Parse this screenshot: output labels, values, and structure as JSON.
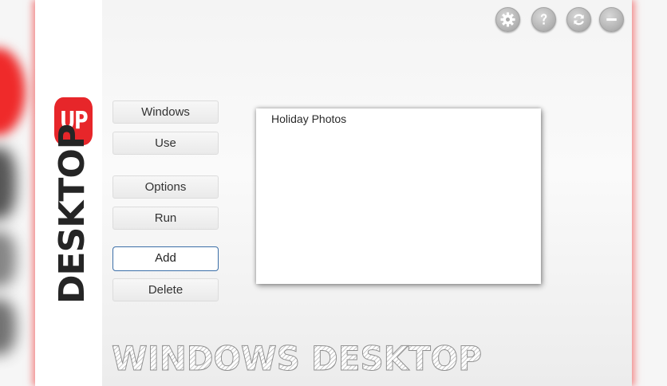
{
  "logo": {
    "up_text": "UP",
    "desktop_text": "DESKTOP",
    "accent_color": "#e7262a"
  },
  "toolbar": {
    "icons": [
      "gear-icon",
      "help-icon",
      "refresh-icon",
      "minimize-icon"
    ]
  },
  "side_buttons": {
    "windows": "Windows",
    "use": "Use",
    "options": "Options",
    "run": "Run",
    "add": "Add",
    "delete": "Delete"
  },
  "list": {
    "items": [
      "Holiday Photos"
    ]
  },
  "footer": {
    "label": "WINDOWS DESKTOP"
  }
}
